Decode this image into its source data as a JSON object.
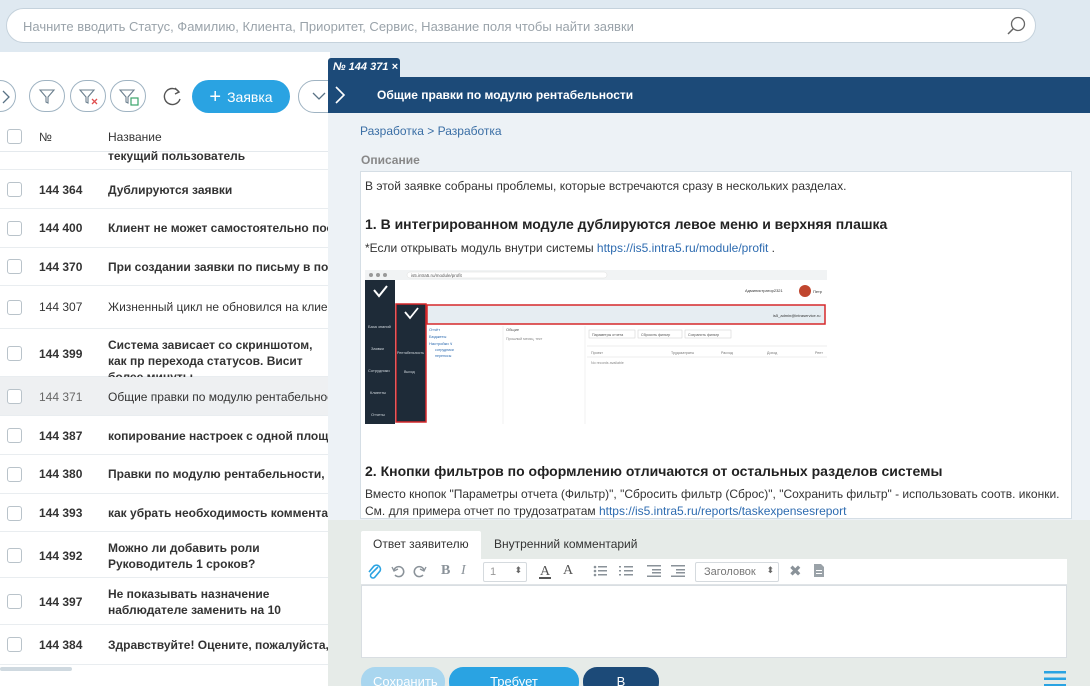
{
  "search": {
    "placeholder": "Начните вводить Статус, Фамилию, Клиента, Приоритет, Сервис, Название поля чтобы найти заявки"
  },
  "toolbar": {
    "add_label": "Заявка"
  },
  "list": {
    "col_no": "№",
    "col_name": "Название",
    "partial_row": "текущий пользователь",
    "rows": [
      {
        "num": "144 364",
        "title": "Дублируются заявки"
      },
      {
        "num": "144 400",
        "title": "Клиент не может самостоятельно постав"
      },
      {
        "num": "144 370",
        "title": "При создании заявки по письму в поле от"
      },
      {
        "num": "144 307",
        "title": "Жизненный цикл не обновился на клиент"
      },
      {
        "num": "144 399",
        "title": "Система зависает со скриншотом, как пр перехода статусов. Висит более минуты"
      },
      {
        "num": "144 371",
        "title": "Общие правки по модулю рентабельность"
      },
      {
        "num": "144 387",
        "title": "копирование настроек с одной площадки"
      },
      {
        "num": "144 380",
        "title": "Правки по модулю рентабельности, разд"
      },
      {
        "num": "144 393",
        "title": "как убрать необходимость комментарий"
      },
      {
        "num": "144 392",
        "title": "Можно ли добавить роли Руководитель 1 сроков?"
      },
      {
        "num": "144 397",
        "title": "Не показывать назначение наблюдателе заменить на 10"
      },
      {
        "num": "144 384",
        "title": "Здравствуйте! Оцените, пожалуйста, дора"
      }
    ]
  },
  "detail": {
    "tab_label": "№ 144 371 ×",
    "title": "Общие правки по модулю рентабельности",
    "breadcrumb": "Разработка > Разработка",
    "desc_label": "Описание",
    "p1": "В этой заявке собраны проблемы, которые встречаются сразу в нескольких разделах.",
    "h1": "1. В интегрированном модуле дублируются левое меню и верхняя плашка",
    "p2_text": "*Если открывать модуль внутри системы ",
    "p2_link": "https://is5.intra5.ru/module/profit",
    "p2_end": " .",
    "h2": "2. Кнопки фильтров по оформлению отличаются от остальных разделов системы",
    "p3_text": "Вместо кнопок \"Параметры отчета (Фильтр)\", \"Сбросить фильтр (Сброс)\", \"Сохранить фильтр\" - использовать соотв. иконки. См. для примера отчет по трудозатратам ",
    "p3_link": "https://is5.intra5.ru/reports/taskexpensesreport"
  },
  "screenshot": {
    "url": "is5.intra5.ru/module/profit",
    "user": "Администратор2321",
    "user_short": "Петр",
    "email": "is5_admin@intraservice.ru",
    "nav": [
      "База знаний",
      "Заявки",
      "Сотрудники",
      "Клиенты",
      "Отчеты"
    ],
    "side2": [
      "Рентабельность",
      "Выход"
    ],
    "menu_title": "Отчёт",
    "menu_items": [
      "Бюджеты",
      "Настройки ∨",
      "сотрудники",
      "переносы"
    ],
    "col2_title": "Общие",
    "col2_sub": "Прошлый месяц, тект",
    "buttons": [
      "Параметры отчета",
      "Сбросить фильтр",
      "Сохранить фильтр"
    ],
    "table_cols": [
      "Проект",
      "Трудозатраты",
      "Расход",
      "Доход",
      "Рент"
    ],
    "no_records": "No records available"
  },
  "reply": {
    "tab_active": "Ответ заявителю",
    "tab_inactive": "Внутренний комментарий",
    "size_value": "1",
    "font_value": "Заголовок",
    "btn_save": "Сохранить",
    "btn_clarify": "Требует уточнения",
    "btn_work": "В работу!"
  },
  "colors": {
    "accent": "#2aa3e2",
    "header": "#1c4a78",
    "link": "#2d6bb0"
  }
}
